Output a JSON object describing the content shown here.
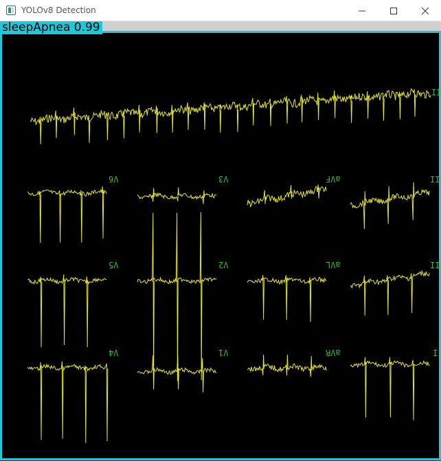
{
  "window": {
    "title": "YOLOv8 Detection",
    "icon": "app-window-icon",
    "controls": [
      "minimize-icon",
      "maximize-icon",
      "close-icon"
    ]
  },
  "detection": {
    "label": "sleepApnea 0.99",
    "box_color": "#1fc8d8"
  },
  "ecg": {
    "trace_color": "#e6e62a",
    "label_color": "#2fbf2f",
    "background": "#000000",
    "lead_labels": {
      "v6": "V6",
      "v3": "V3",
      "avf": "aVF",
      "iii": "III",
      "v5": "V5",
      "v2": "V2",
      "avl": "aVL",
      "ii": "II",
      "v4": "V4",
      "v1": "V1",
      "avr": "aVR",
      "i": "I",
      "rhythm": "II"
    }
  }
}
